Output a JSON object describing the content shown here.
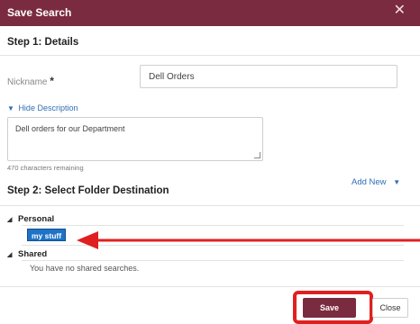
{
  "dialog": {
    "title": "Save Search"
  },
  "step1": {
    "title": "Step 1: Details",
    "nickname_label": "Nickname",
    "required_marker": "*",
    "nickname_value": "Dell Orders",
    "hide_description": "Hide Description",
    "description_value": "Dell orders for our Department",
    "chars_remaining": "470 characters remaining"
  },
  "step2": {
    "title": "Step 2: Select Folder Destination",
    "add_new": "Add New",
    "personal_label": "Personal",
    "personal_folder": "my stuff",
    "shared_label": "Shared",
    "shared_empty": "You have no shared searches."
  },
  "footer": {
    "save_label": "Save",
    "close_label": "Close"
  },
  "colors": {
    "brand": "#7b2b3f",
    "link": "#2f6fb5",
    "selected": "#1f73c7",
    "annotation": "#e02020"
  }
}
